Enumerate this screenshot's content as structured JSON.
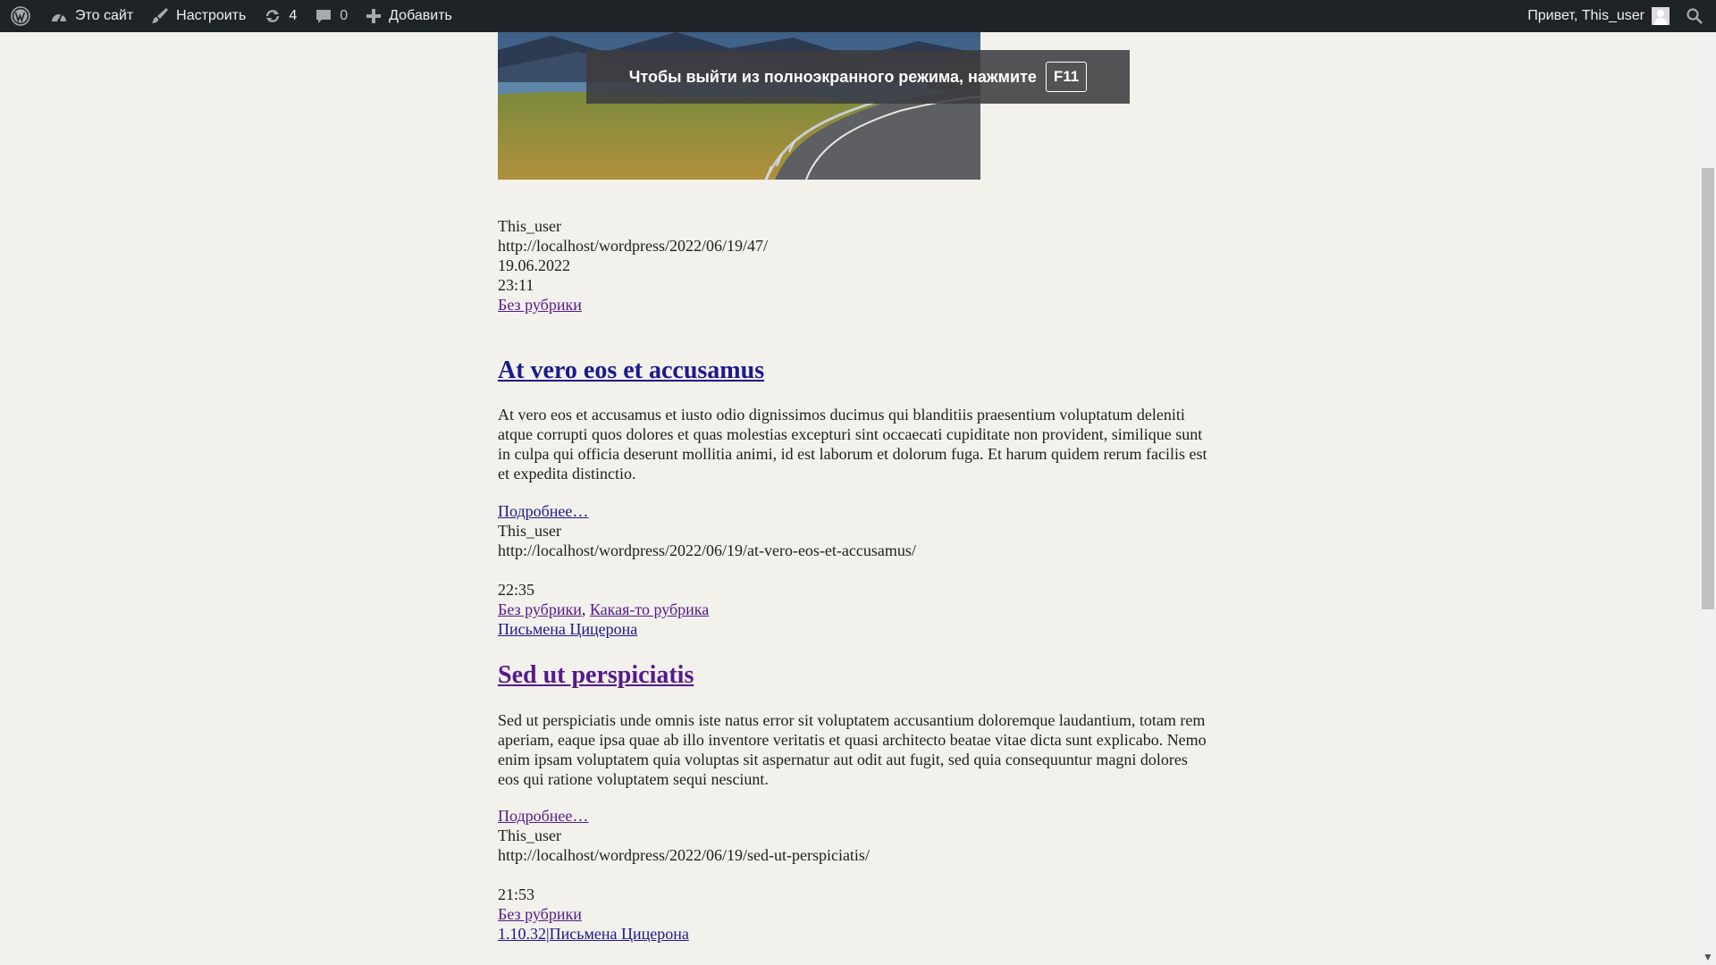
{
  "admin_bar": {
    "site_label": "Это сайт",
    "customize_label": "Настроить",
    "updates_count": "4",
    "comments_count": "0",
    "add_label": "Добавить",
    "greeting": "Привет, This_user"
  },
  "fullscreen_toast": {
    "message": "Чтобы выйти из полноэкранного режима, нажмите",
    "key": "F11"
  },
  "post_top": {
    "author": "This_user",
    "url": "http://localhost/wordpress/2022/06/19/47/",
    "date": "19.06.2022",
    "time": "23:11",
    "category": "Без рубрики"
  },
  "post1": {
    "title": "At vero eos et accusamus",
    "body": "At vero eos et accusamus et iusto odio dignissimos ducimus qui blanditiis praesentium voluptatum deleniti atque corrupti quos dolores et quas molestias excepturi sint occaecati cupiditate non provident, similique sunt in culpa qui officia deserunt mollitia animi, id est laborum et dolorum fuga. Et harum quidem rerum facilis est et expedita distinctio.",
    "more": "Подробнее…",
    "author": "This_user",
    "url": "http://localhost/wordpress/2022/06/19/at-vero-eos-et-accusamus/",
    "time": "22:35",
    "category1": "Без рубрики",
    "separator": ",",
    "category2": "Какая-то рубрика",
    "tag": "Письмена Цицерона"
  },
  "post2": {
    "title": "Sed ut perspiciatis",
    "body": "Sed ut perspiciatis unde omnis iste natus error sit voluptatem accusantium doloremque laudantium, totam rem aperiam, eaque ipsa quae ab illo inventore veritatis et quasi architecto beatae vitae dicta sunt explicabo. Nemo enim ipsam voluptatem quia voluptas sit aspernatur aut odit aut fugit, sed quia consequuntur magni dolores eos qui ratione voluptatem sequi nesciunt.",
    "more": "Подробнее…",
    "author": "This_user",
    "url": "http://localhost/wordpress/2022/06/19/sed-ut-perspiciatis/",
    "time": "21:53",
    "category": "Без рубрики",
    "tag1": "1.10.32",
    "tag_separator": "|",
    "tag2": "Письмена Цицерона"
  },
  "colors": {
    "admin_bar_bg": "#1d2327",
    "page_bg": "#f3f1ec",
    "link": "#1a1a8a",
    "visited_link": "#551a8b"
  },
  "icons": [
    "wordpress-icon",
    "dashboard-icon",
    "brush-icon",
    "updates-icon",
    "comment-icon",
    "plus-icon",
    "search-icon"
  ]
}
